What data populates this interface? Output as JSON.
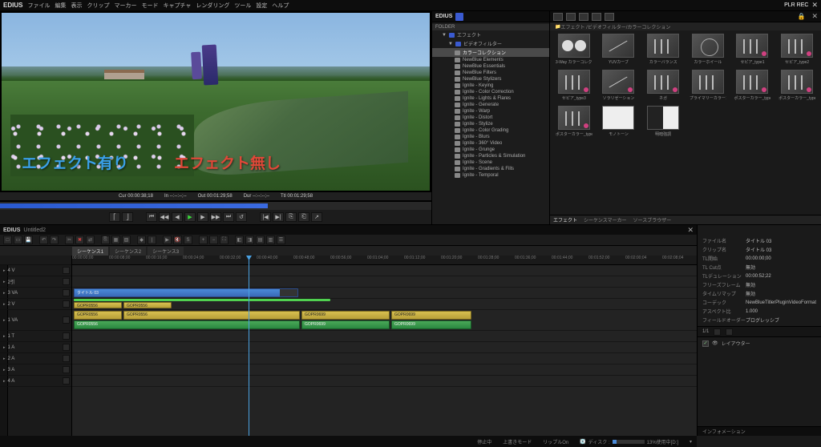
{
  "topbar": {
    "brand": "EDIUS",
    "menus": [
      "ファイル",
      "編集",
      "表示",
      "クリップ",
      "マーカー",
      "モード",
      "キャプチャ",
      "レンダリング",
      "ツール",
      "設定",
      "ヘルプ"
    ],
    "plr": "PLR REC"
  },
  "preview": {
    "overlay_left": "エフェクト有り",
    "overlay_right": "エフェクト無し",
    "tc": {
      "cur": "Cur 00:00:38;18",
      "in": "In --:--:--;--",
      "out": "Out 00:01:29;58",
      "dur": "Dur --:--:--;--",
      "ttl": "Ttl 00:01:29;58"
    }
  },
  "folder": {
    "brand": "EDIUS",
    "header": "FOLDER",
    "root": "エフェクト",
    "video_filter": "ビデオフィルター",
    "selected": "カラーコレクション",
    "nodes": [
      "NewBlue Elements",
      "NewBlue Essentials",
      "NewBlue Filters",
      "NewBlue Stylizers",
      "Ignite - Keying",
      "Ignite - Color Correction",
      "Ignite - Lights & Flares",
      "Ignite - Generate",
      "Ignite - Warp",
      "Ignite - Distort",
      "Ignite - Stylize",
      "Ignite - Color Grading",
      "Ignite - Blurs",
      "Ignite - 360° Video",
      "Ignite - Grunge",
      "Ignite - Particles & Simulation",
      "Ignite - Scene",
      "Ignite - Gradients & Fills",
      "Ignite - Temporal"
    ]
  },
  "fx": {
    "crumb": "エフェクト /ビデオフィルター/カラーコレクション",
    "items": [
      {
        "label": "3-Way カラーコレクション",
        "t": "circles"
      },
      {
        "label": "YUVカーブ",
        "t": "line"
      },
      {
        "label": "カラーバランス",
        "t": "sliders"
      },
      {
        "label": "カラーホイール",
        "t": "wheel"
      },
      {
        "label": "セピア_type1",
        "t": "sliders",
        "dot": true
      },
      {
        "label": "セピア_type2",
        "t": "sliders",
        "dot": true
      },
      {
        "label": "セピア_type3",
        "t": "sliders",
        "dot": true
      },
      {
        "label": "ソラリゼーション",
        "t": "line",
        "dot": true
      },
      {
        "label": "ネガ",
        "t": "sliders",
        "dot": true
      },
      {
        "label": "プライマリーカラーコレクシ…",
        "t": "sliders"
      },
      {
        "label": "ポスターカラー_type1",
        "t": "sliders",
        "dot": true
      },
      {
        "label": "ポスターカラー_type2",
        "t": "sliders",
        "dot": true
      },
      {
        "label": "ポスターカラー_type3",
        "t": "sliders",
        "dot": true
      },
      {
        "label": "モノトーン",
        "t": "white"
      },
      {
        "label": "明暗強調",
        "t": "split"
      }
    ],
    "tabs": [
      "エフェクト",
      "シーケンスマーカー",
      "ソースブラウザー"
    ]
  },
  "timeline": {
    "brand": "EDIUS",
    "project": "Untitled2",
    "seq_tabs": [
      "シーケンス1",
      "シーケンス2",
      "シーケンス3"
    ],
    "ruler": [
      "00:00:00;00",
      "00:00:08;00",
      "00:00:16;00",
      "00:00:24;00",
      "00:00:32;00",
      "00:00:40;00",
      "00:00:48;00",
      "00:00:56;00",
      "00:01:04;00",
      "00:01:12;00",
      "00:01:20;00",
      "00:01:28;00",
      "00:01:36;00",
      "00:01:44;00",
      "00:01:52;00",
      "00:02:00;04",
      "00:02:08;04"
    ],
    "tracks": [
      "4 V",
      "2引",
      "3 VA",
      "2 V",
      "1 VA",
      "1 T",
      "1 A",
      "2 A",
      "3 A",
      "4 A"
    ],
    "clips": {
      "title": "タイトル 03",
      "v1": "GOPR0556",
      "v2": "GOPR0556",
      "v3": "GOPR0556",
      "a1": "GOPR0556",
      "a2": "GOPR0556",
      "a3": "GOPR0699",
      "a4": "GOPR0699"
    }
  },
  "status": {
    "stop": "停止中",
    "overwrite": "上書きモード",
    "ripple": "リップルOn",
    "disk_label": "ディスク :",
    "disk_pct": "13%使用中[D:]"
  },
  "info": {
    "rows": [
      {
        "k": "ファイル名",
        "v": "タイトル 03"
      },
      {
        "k": "クリップ名",
        "v": "タイトル 03"
      },
      {
        "k": "TL開始",
        "v": "00:00:00;00"
      },
      {
        "k": "TL Cut点",
        "v": "無効"
      },
      {
        "k": "TLデュレーション",
        "v": "00:00:52;22"
      },
      {
        "k": "フリーズフレーム",
        "v": "無効"
      },
      {
        "k": "タイムリマップ",
        "v": "無効"
      },
      {
        "k": "コーデック",
        "v": "NewBlueTitlerPluginVideoFormat"
      },
      {
        "k": "アスペクト比",
        "v": "1.000"
      },
      {
        "k": "フィールドオーダー",
        "v": "プログレッシブ"
      }
    ],
    "sec": "1/1",
    "layouter": "レイアウター",
    "footer": "インフォメーション"
  }
}
